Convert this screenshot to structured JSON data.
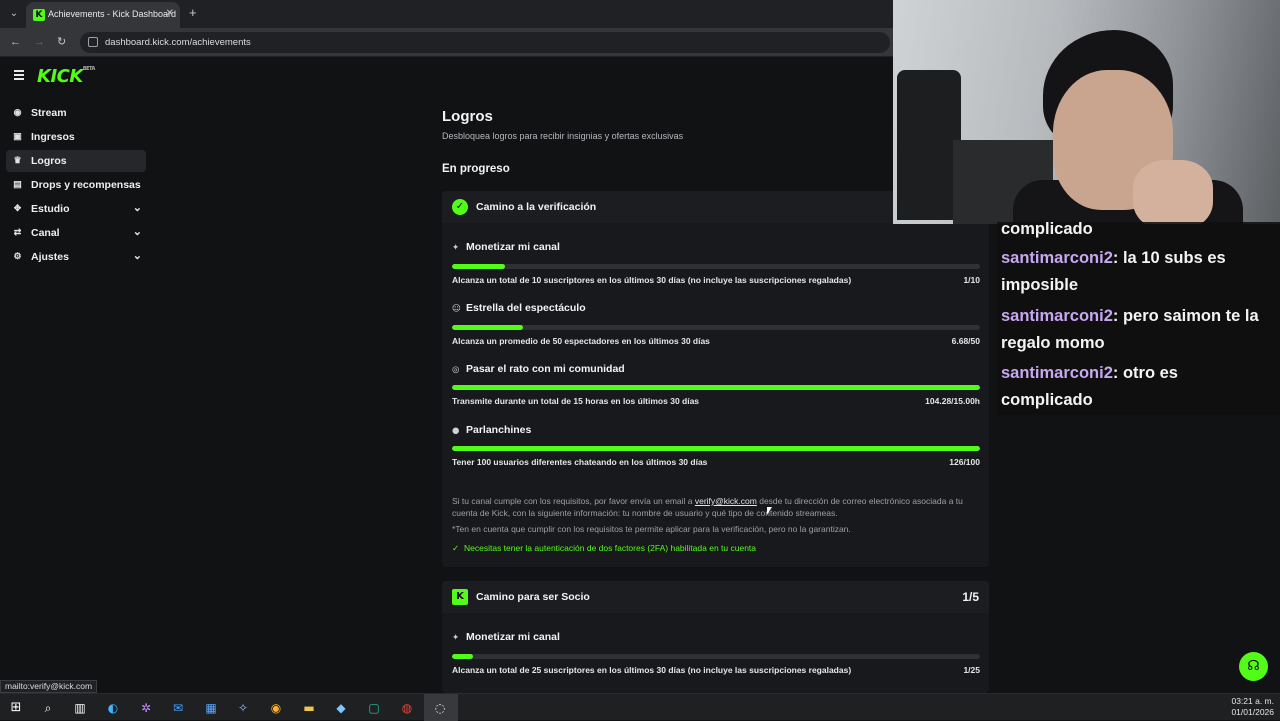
{
  "browser": {
    "tab_title": "Achievements - Kick Dashboard",
    "url": "dashboard.kick.com/achievements",
    "status_link": "mailto:verify@kick.com"
  },
  "sidebar": {
    "logo": "KICK",
    "logo_badge": "BETA",
    "items": [
      {
        "label": "Stream",
        "icon": "stream-icon"
      },
      {
        "label": "Ingresos",
        "icon": "income-icon"
      },
      {
        "label": "Logros",
        "icon": "trophy-icon",
        "active": true
      },
      {
        "label": "Drops y recompensas",
        "icon": "gift-icon"
      },
      {
        "label": "Estudio",
        "icon": "studio-icon",
        "expandable": true
      },
      {
        "label": "Canal",
        "icon": "channel-icon",
        "expandable": true
      },
      {
        "label": "Ajustes",
        "icon": "gear-icon",
        "expandable": true
      }
    ]
  },
  "page": {
    "title": "Logros",
    "subtitle": "Desbloquea logros para recibir insignias y ofertas exclusivas",
    "section": "En progreso"
  },
  "card1": {
    "title": "Camino a la verificación",
    "achievements": [
      {
        "title": "Monetizar mi canal",
        "icon": "sparkle-icon",
        "desc": "Alcanza un total de 10 suscriptores en los últimos 30 días (no incluye las suscripciones regaladas)",
        "value": "1/10",
        "progress": 0.1
      },
      {
        "title": "Estrella del espectáculo",
        "icon": "viewers-icon",
        "desc": "Alcanza un promedio de 50 espectadores en los últimos 30 días",
        "value": "6.68/50",
        "progress": 0.1336
      },
      {
        "title": "Pasar el rato con mi comunidad",
        "icon": "broadcast-icon",
        "desc": "Transmite durante un total de 15 horas en los últimos 30 días",
        "value": "104.28/15.00h",
        "progress": 1.0
      },
      {
        "title": "Parlanchines",
        "icon": "chat-icon",
        "desc": "Tener 100 usuarios diferentes chateando en los últimos 30 días",
        "value": "126/100",
        "progress": 1.0
      }
    ],
    "note_before": "Si tu canal cumple con los requisitos, por favor envía un email a ",
    "note_email": "verify@kick.com",
    "note_after": " desde tu dirección de correo electrónico asociada a tu cuenta de Kick, con la siguiente información: tu nombre de usuario y qué tipo de contenido streameas.",
    "note2": "*Ten en cuenta que cumplir con los requisitos te permite aplicar para la verificación, pero no la garantizan.",
    "check": "Necesitas tener la autenticación de dos factores (2FA) habilitada en tu cuenta"
  },
  "card2": {
    "title": "Camino para ser Socio",
    "count": "1/5",
    "achievements": [
      {
        "title": "Monetizar mi canal",
        "icon": "sparkle-icon",
        "desc": "Alcanza un total de 25 suscriptores en los últimos 30 días (no incluye las suscripciones regaladas)",
        "value": "1/25",
        "progress": 0.04
      }
    ]
  },
  "chat": {
    "partial_top": "complicado",
    "messages": [
      {
        "user": "santimarconi2",
        "text": ": la 10 subs es imposible"
      },
      {
        "user": "santimarconi2",
        "text": ": pero saimon te la regalo momo"
      },
      {
        "user": "santimarconi2",
        "text": ": otro es complicado"
      }
    ]
  },
  "taskbar": {
    "time": "03:21 a. m.",
    "date": "01/01/2026"
  },
  "colors": {
    "accent": "#53fc18",
    "bg": "#111214",
    "card": "#18191c",
    "chat_user": "#c7a7f0"
  }
}
